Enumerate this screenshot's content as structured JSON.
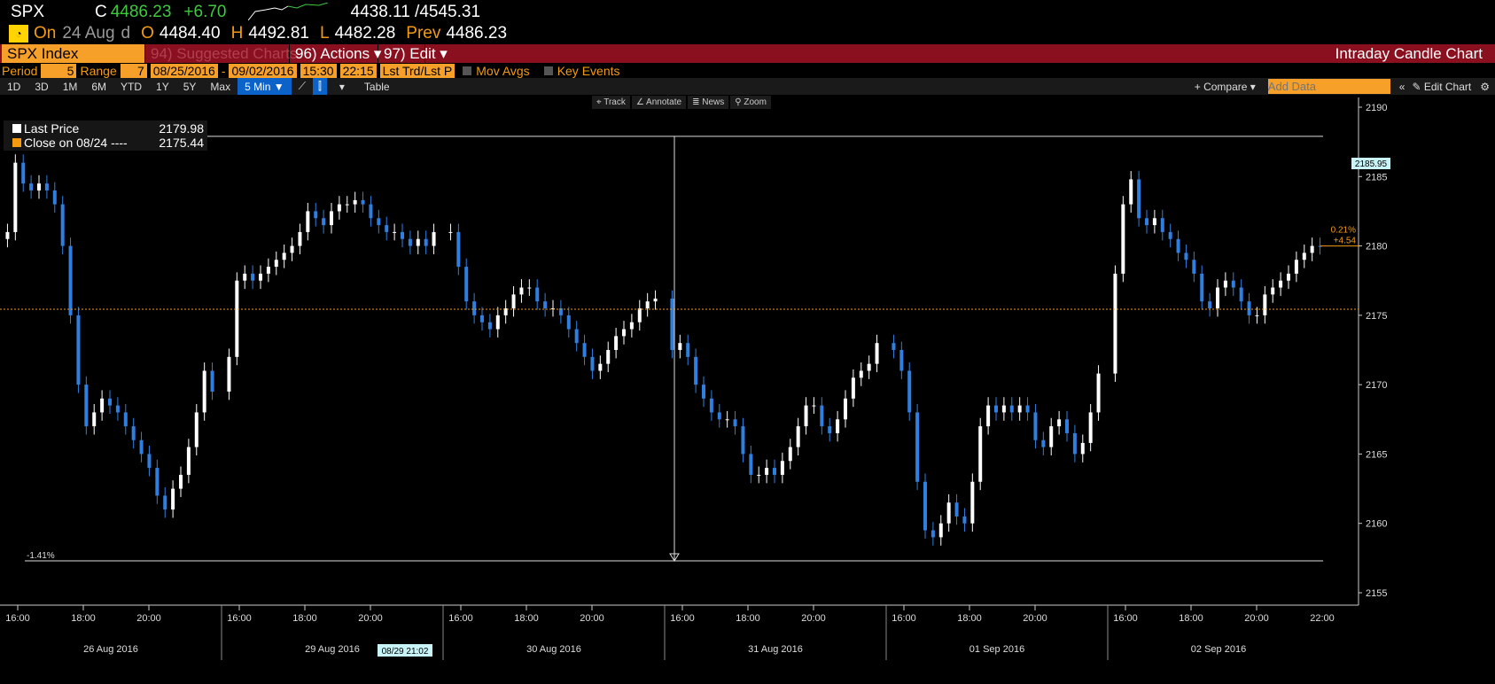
{
  "header": {
    "ticker": "SPX",
    "c_label": "C",
    "last": "4486.23",
    "change": "+6.70",
    "range": "4438.11 /4545.31",
    "on_label": "On",
    "date": "24 Aug",
    "d": "d",
    "o_label": "O",
    "open": "4484.40",
    "h_label": "H",
    "high": "4492.81",
    "l_label": "L",
    "low": "4482.28",
    "prev_label": "Prev",
    "prev": "4486.23"
  },
  "menubar": {
    "security": "SPX Index",
    "suggested": "94) Suggested Charts",
    "actions": "96) Actions ▾",
    "edit": "97) Edit ▾",
    "title": "Intraday Candle Chart"
  },
  "params": {
    "period_label": "Period",
    "period": "5",
    "range_label": "Range",
    "range": "7",
    "start": "08/25/2016",
    "end": "09/02/2016",
    "t_start": "15:30",
    "t_end": "22:15",
    "price_type": "Lst Trd/Lst P",
    "mov_avgs": "Mov Avgs",
    "key_events": "Key Events"
  },
  "toolbar": {
    "ranges": [
      "1D",
      "3D",
      "1M",
      "6M",
      "YTD",
      "1Y",
      "5Y",
      "Max"
    ],
    "interval": "5 Min ▼",
    "table": "Table",
    "compare": "+ Compare ▾",
    "add_data_placeholder": "Add Data",
    "edit_chart": "Edit Chart"
  },
  "chart_tools": [
    "⌖ Track",
    "∠ Annotate",
    "≣ News",
    "⚲ Zoom"
  ],
  "legend": {
    "last_label": "Last Price",
    "last_value": "2179.98",
    "close_label": "Close on 08/24 ----",
    "close_value": "2175.44"
  },
  "colors": {
    "up": "#ffffff",
    "down": "#2f7fe0",
    "ref": "#f39c12",
    "accent": "#f6a02a",
    "bar": "#8a1020"
  },
  "chart_data": {
    "type": "candlestick",
    "interval": "15 min (approx. closes)",
    "ylim": [
      2153,
      2191
    ],
    "yticks": [
      2155,
      2160,
      2165,
      2170,
      2175,
      2180,
      2185,
      2190
    ],
    "days": [
      "26 Aug 2016",
      "29 Aug 2016",
      "30 Aug 2016",
      "31 Aug 2016",
      "01 Sep 2016",
      "02 Sep 2016"
    ],
    "xticks": [
      "16:00",
      "18:00",
      "20:00"
    ],
    "last_xtick": "22:00",
    "cursor_label": "08/29 21:02",
    "closes": [
      [
        2181,
        2186,
        2184.5,
        2184,
        2184.5,
        2184,
        2183,
        2180,
        2175,
        2170,
        2167,
        2168,
        2169,
        2168.5,
        2168,
        2167,
        2166,
        2165,
        2164,
        2162,
        2161,
        2162.5,
        2163.5,
        2165.5,
        2168,
        2171,
        2169.5
      ],
      [
        2172,
        2177.5,
        2178,
        2177.5,
        2178,
        2178.5,
        2179,
        2179.5,
        2180,
        2181,
        2182.5,
        2182,
        2181.5,
        2182.5,
        2183,
        2183,
        2183.3,
        2183,
        2182,
        2181.5,
        2181,
        2181,
        2180.5,
        2180,
        2180.5,
        2180,
        2181
      ],
      [
        2181,
        2178.5,
        2176,
        2175,
        2174.5,
        2174,
        2175,
        2175.5,
        2176.5,
        2177,
        2177,
        2176,
        2175.5,
        2175.5,
        2175,
        2174,
        2173,
        2172,
        2171,
        2171.5,
        2172.5,
        2173.5,
        2174,
        2174.5,
        2175.5,
        2176,
        2176.2
      ],
      [
        2172.5,
        2173,
        2172,
        2170,
        2169,
        2168,
        2167.5,
        2167.5,
        2167,
        2165,
        2163.5,
        2163.5,
        2164,
        2163.5,
        2164.5,
        2165.5,
        2167,
        2168.5,
        2168.5,
        2167,
        2166.5,
        2167.5,
        2169,
        2170.5,
        2171,
        2171.5,
        2173
      ],
      [
        2172.5,
        2171,
        2168,
        2163,
        2159.5,
        2159,
        2160,
        2161.5,
        2160.5,
        2160,
        2163,
        2167,
        2168.5,
        2168,
        2168.5,
        2168,
        2168.5,
        2168,
        2166,
        2165.5,
        2167,
        2167.5,
        2166.5,
        2165,
        2165.8,
        2168,
        2170.8
      ],
      [
        2178,
        2183,
        2184.8,
        2182,
        2181.5,
        2182,
        2181,
        2180.5,
        2179.5,
        2179,
        2178,
        2176,
        2175.5,
        2177,
        2177.5,
        2177,
        2176,
        2175,
        2175,
        2176.5,
        2177,
        2177.5,
        2178,
        2179,
        2179.5,
        2180,
        2179.98
      ]
    ],
    "high_line": 2187.9,
    "low_line": 2157.3,
    "low_pct": "-1.41%",
    "ref_close": 2175.44,
    "ref_pct": "0.21%",
    "ref_chg": "+4.54",
    "crosshair_price": "2185.95"
  }
}
